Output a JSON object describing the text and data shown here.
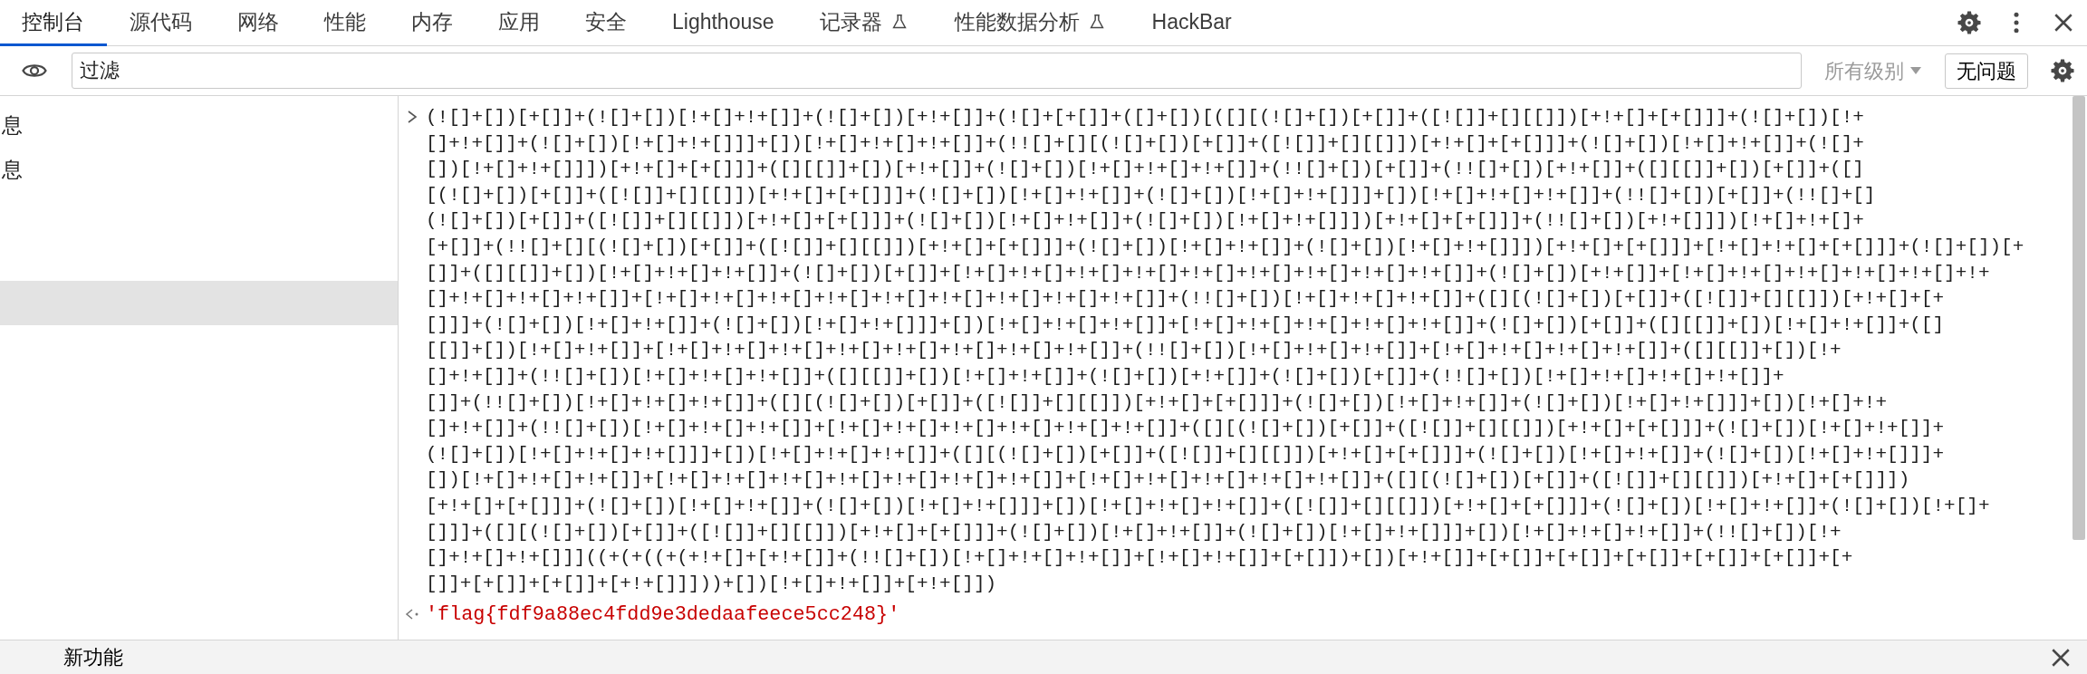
{
  "tabs": [
    {
      "label": "控制台",
      "selected": true,
      "experimental": false
    },
    {
      "label": "源代码",
      "selected": false,
      "experimental": false
    },
    {
      "label": "网络",
      "selected": false,
      "experimental": false
    },
    {
      "label": "性能",
      "selected": false,
      "experimental": false
    },
    {
      "label": "内存",
      "selected": false,
      "experimental": false
    },
    {
      "label": "应用",
      "selected": false,
      "experimental": false
    },
    {
      "label": "安全",
      "selected": false,
      "experimental": false
    },
    {
      "label": "Lighthouse",
      "selected": false,
      "experimental": false
    },
    {
      "label": "记录器",
      "selected": false,
      "experimental": true
    },
    {
      "label": "性能数据分析",
      "selected": false,
      "experimental": true
    },
    {
      "label": "HackBar",
      "selected": false,
      "experimental": false
    }
  ],
  "filter": {
    "placeholder": "过滤"
  },
  "levels": {
    "label": "所有级别",
    "disabled": true
  },
  "issues_button": "无问题",
  "sidebar": {
    "items": [
      {
        "label": "息",
        "selected": false
      },
      {
        "label": "息",
        "selected": false
      },
      {
        "selected": true
      }
    ]
  },
  "console": {
    "input_lines": [
      "(![]+[])[+[]]+(![]+[])[!+[]+!+[]]+(![]+[])[+!+[]]+(![]+[+[]]+([]+[])[([][(![]+[])[+[]]+([![]]+[][[]])[+!+[]+[+[]]]+(![]+[])[!+",
      "[]+!+[]]+(![]+[])[!+[]+!+[]]]+[])[!+[]+!+[]+!+[]]+(!![]+[][(![]+[])[+[]]+([![]]+[][[]])[+!+[]+[+[]]]+(![]+[])[!+[]+!+[]]+(![]+",
      "[])[!+[]+!+[]]])[+!+[]+[+[]]]+([][[]]+[])[+!+[]]+(![]+[])[!+[]+!+[]+!+[]]+(!![]+[])[+[]]+(!![]+[])[+!+[]]+([][[]]+[])[+[]]+([]",
      "[(![]+[])[+[]]+([![]]+[][[]])[+!+[]+[+[]]]+(![]+[])[!+[]+!+[]]+(![]+[])[!+[]+!+[]]]+[])[!+[]+!+[]+!+[]]+(!![]+[])[+[]]+(!![]+[]",
      "(![]+[])[+[]]+([![]]+[][[]])[+!+[]+[+[]]]+(![]+[])[!+[]+!+[]]+(![]+[])[!+[]+!+[]]])[+!+[]+[+[]]]+(!![]+[])[+!+[]]])[!+[]+!+[]+",
      "[+[]]+(!![]+[][(![]+[])[+[]]+([![]]+[][[]])[+!+[]+[+[]]]+(![]+[])[!+[]+!+[]]+(![]+[])[!+[]+!+[]]])[+!+[]+[+[]]]+[!+[]+!+[]+[+[]]]+(![]+[])[+",
      "[]]+([][[]]+[])[!+[]+!+[]+!+[]]+(![]+[])[+[]]+[!+[]+!+[]+!+[]+!+[]+!+[]+!+[]+!+[]+!+[]+!+[]]+(![]+[])[+!+[]]+[!+[]+!+[]+!+[]+!+[]+!+[]+!+",
      "[]+!+[]+!+[]+!+[]]+[!+[]+!+[]+!+[]+!+[]+!+[]+!+[]+!+[]+!+[]+!+[]]+(!![]+[])[!+[]+!+[]+!+[]]+([][(![]+[])[+[]]+([![]]+[][[]])[+!+[]+[+",
      "[]]]+(![]+[])[!+[]+!+[]]+(![]+[])[!+[]+!+[]]]+[])[!+[]+!+[]+!+[]]+[!+[]+!+[]+!+[]+!+[]+!+[]]+(![]+[])[+[]]+([][[]]+[])[!+[]+!+[]]+([]",
      "[[]]+[])[!+[]+!+[]]+[!+[]+!+[]+!+[]+!+[]+!+[]+!+[]+!+[]+!+[]]+(!![]+[])[!+[]+!+[]+!+[]]+[!+[]+!+[]+!+[]+!+[]]+([][[]]+[])[!+",
      "[]+!+[]]+(!![]+[])[!+[]+!+[]+!+[]]+([][[]]+[])[!+[]+!+[]]+(![]+[])[+!+[]]+(![]+[])[+[]]+(!![]+[])[!+[]+!+[]+!+[]+!+[]]+",
      "[]]+(!![]+[])[!+[]+!+[]+!+[]]+([][(![]+[])[+[]]+([![]]+[][[]])[+!+[]+[+[]]]+(![]+[])[!+[]+!+[]]+(![]+[])[!+[]+!+[]]]+[])[!+[]+!+",
      "[]+!+[]]+(!![]+[])[!+[]+!+[]+!+[]]+[!+[]+!+[]+!+[]+!+[]+!+[]+!+[]]+([][(![]+[])[+[]]+([![]]+[][[]])[+!+[]+[+[]]]+(![]+[])[!+[]+!+[]]+",
      "(![]+[])[!+[]+!+[]+!+[]]]+[])[!+[]+!+[]+!+[]]+([][(![]+[])[+[]]+([![]]+[][[]])[+!+[]+[+[]]]+(![]+[])[!+[]+!+[]]+(![]+[])[!+[]+!+[]]]+",
      "[])[!+[]+!+[]+!+[]]+[!+[]+!+[]+!+[]+!+[]+!+[]+!+[]+!+[]]+[!+[]+!+[]+!+[]+!+[]+!+[]]+([][(![]+[])[+[]]+([![]]+[][[]])[+!+[]+[+[]]])",
      "[+!+[]+[+[]]]+(![]+[])[!+[]+!+[]]+(![]+[])[!+[]+!+[]]]+[])[!+[]+!+[]+!+[]]+([![]]+[][[]])[+!+[]+[+[]]]+(![]+[])[!+[]+!+[]]+(![]+[])[!+[]+",
      "[]]]+([][(![]+[])[+[]]+([![]]+[][[]])[+!+[]+[+[]]]+(![]+[])[!+[]+!+[]]+(![]+[])[!+[]+!+[]]]+[])[!+[]+!+[]+!+[]]+(!![]+[])[!+",
      "[]+!+[]+!+[]]]((+(+((+(+!+[]+[+!+[]]+(!![]+[])[!+[]+!+[]+!+[]]+[!+[]+!+[]]+[+[]])+[])[+!+[]]+[+[]]+[+[]]+[+[]]+[+[]]+[+[]]+[+",
      "[]]+[+[]]+[+[]]+[+!+[]]]))+[])[!+[]+!+[]]+[+!+[]])"
    ],
    "result": "'flag{fdf9a88ec4fdd9e3dedaafeece5cc248}'"
  },
  "drawer": {
    "tabs": [
      {
        "label": "新功能"
      }
    ]
  }
}
